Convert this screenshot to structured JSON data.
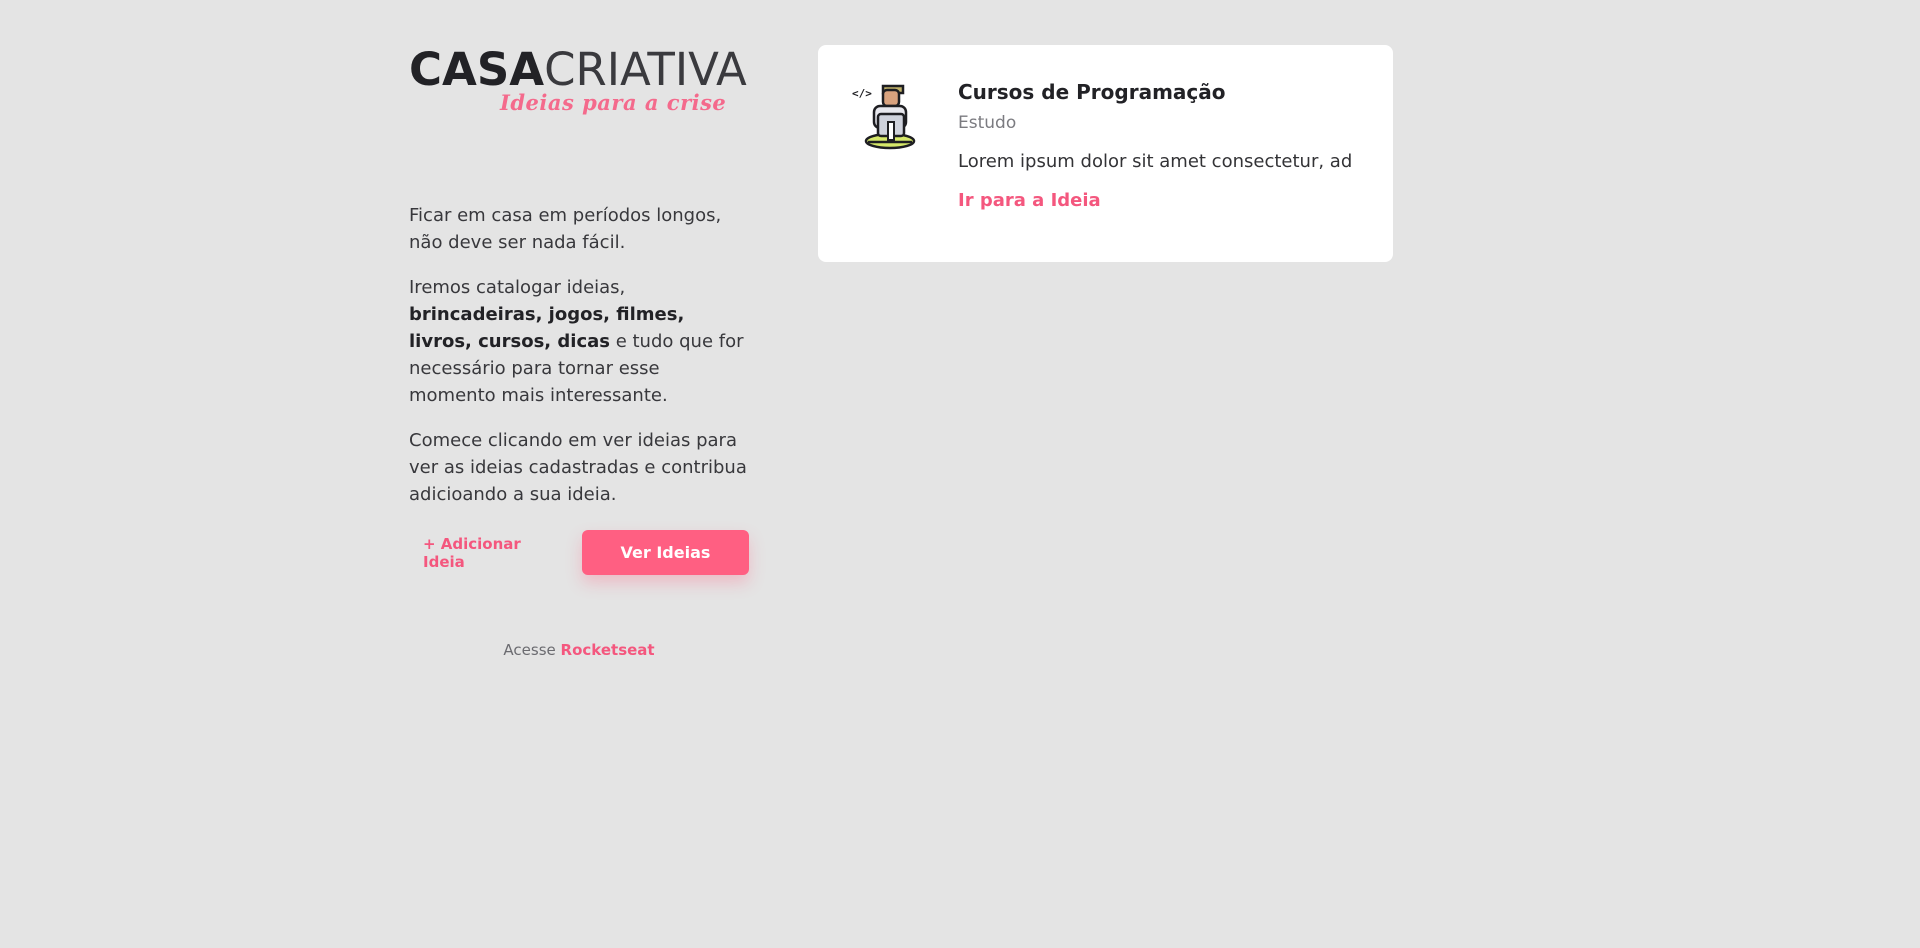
{
  "logo": {
    "main_bold": "CASA",
    "main_light": "CRIATIVA",
    "subtitle": "Ideias para a crise"
  },
  "intro": {
    "p1": "Ficar em casa em períodos longos, não deve ser nada fácil.",
    "p2_before": "Iremos catalogar ideias, ",
    "p2_bold": "brincadeiras, jogos, filmes, livros, cursos, dicas",
    "p2_after": " e tudo que for necessário para tornar esse momento mais interessante.",
    "p3": "Comece clicando em ver ideias para ver as ideias cadastradas e contribua adicioando a sua ideia."
  },
  "actions": {
    "add_label": "+ Adicionar Ideia",
    "view_label": "Ver Ideias"
  },
  "footer": {
    "prefix": "Acesse",
    "link_label": "Rocketseat"
  },
  "card": {
    "icon": "programmer-laptop-icon",
    "title": "Cursos de Programação",
    "category": "Estudo",
    "description": "Lorem ipsum dolor sit amet consectetur, ad",
    "link_label": "Ir para a Ideia"
  },
  "colors": {
    "background": "#e4e4e4",
    "accent": "#ff5f82",
    "card": "#ffffff"
  }
}
